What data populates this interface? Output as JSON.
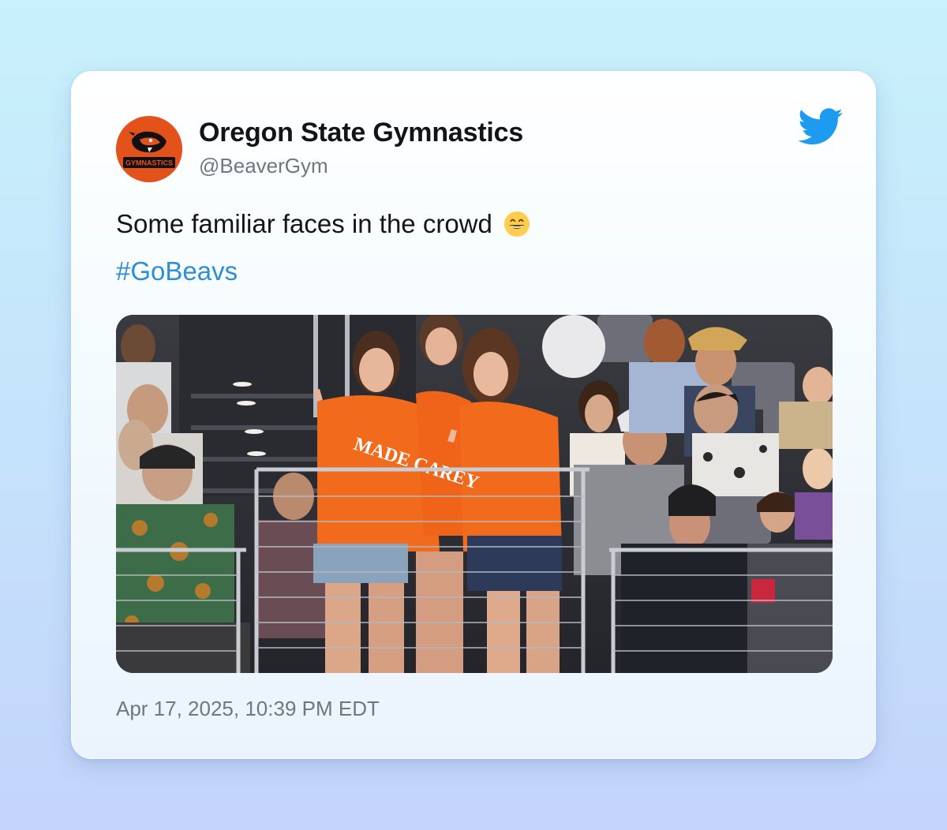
{
  "tweet": {
    "author": {
      "display_name": "Oregon State Gymnastics",
      "handle": "@BeaverGym",
      "avatar_text": "GYMNASTICS"
    },
    "text": "Some familiar faces in the crowd",
    "emoji": "grinning-face-with-smiling-eyes",
    "hashtag": "#GoBeavs",
    "media": {
      "description_icon": "photo",
      "shirt_text": "MADE CAREY"
    },
    "timestamp": "Apr 17, 2025, 10:39 PM EDT",
    "platform_icon": "twitter-bird-icon"
  },
  "colors": {
    "background_top": "#c8f1fb",
    "background_bottom": "#c4d4fb",
    "hashtag": "#2d8ed6",
    "twitter_blue": "#1d9bf0",
    "avatar_orange": "#e4521c",
    "shirt_orange": "#f26a1b"
  }
}
